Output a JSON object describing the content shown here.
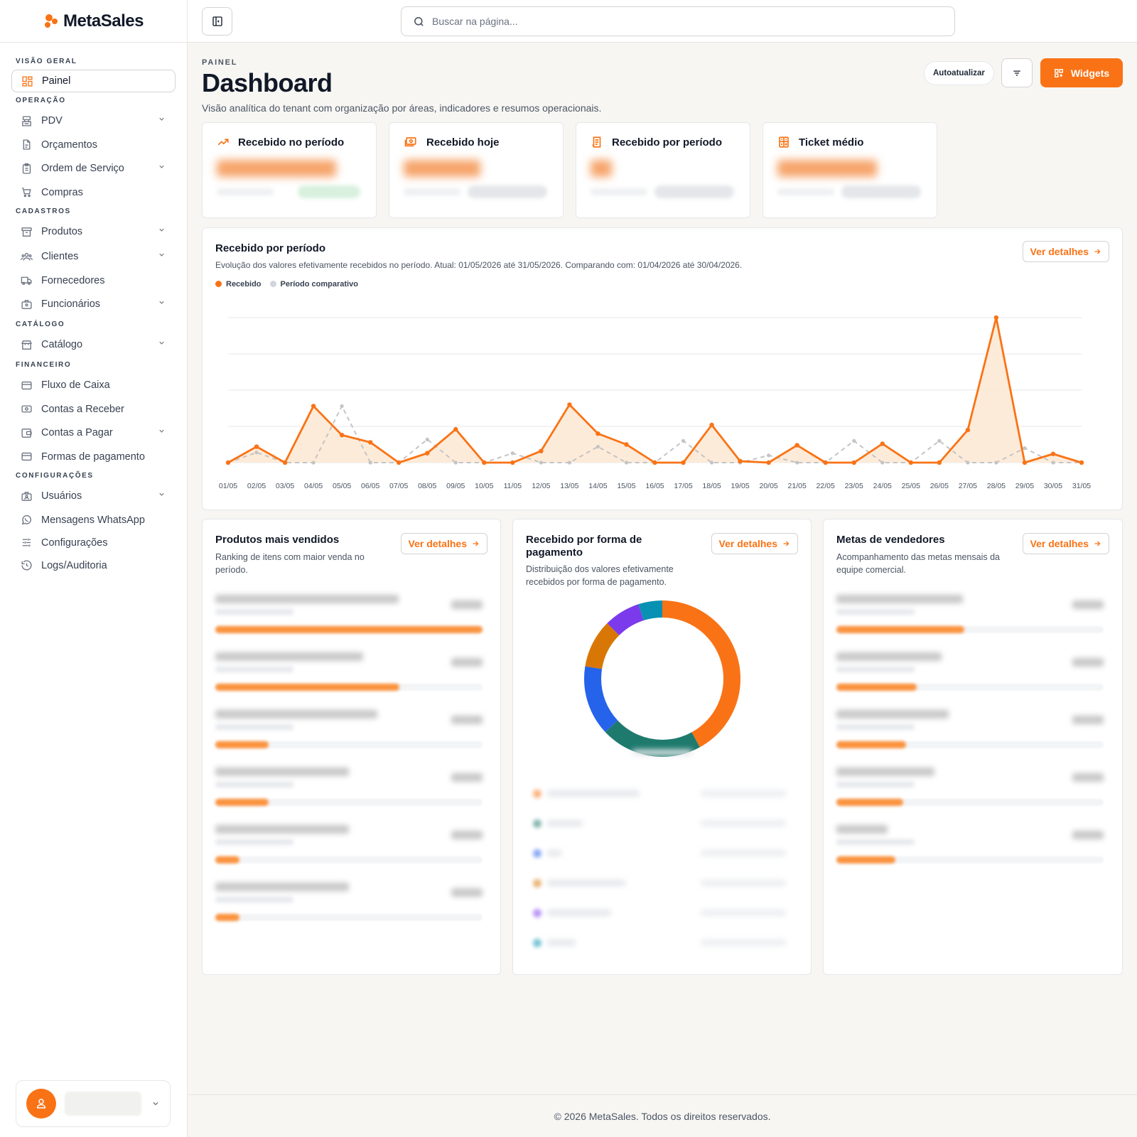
{
  "brand": {
    "name": "MetaSales"
  },
  "search": {
    "placeholder": "Buscar na página..."
  },
  "sidebar": {
    "sections": [
      {
        "title": "VISÃO GERAL",
        "items": [
          {
            "label": "Painel",
            "icon": "dashboard-icon",
            "active": true
          }
        ]
      },
      {
        "title": "OPERAÇÃO",
        "items": [
          {
            "label": "PDV",
            "icon": "register-icon",
            "expand": true
          },
          {
            "label": "Orçamentos",
            "icon": "document-icon"
          },
          {
            "label": "Ordem de Serviço",
            "icon": "clipboard-icon",
            "expand": true
          },
          {
            "label": "Compras",
            "icon": "cart-icon"
          }
        ]
      },
      {
        "title": "CADASTROS",
        "items": [
          {
            "label": "Produtos",
            "icon": "box-icon",
            "expand": true
          },
          {
            "label": "Clientes",
            "icon": "users-icon",
            "expand": true
          },
          {
            "label": "Fornecedores",
            "icon": "truck-icon"
          },
          {
            "label": "Funcionários",
            "icon": "briefcase-icon",
            "expand": true
          }
        ]
      },
      {
        "title": "CATÁLOGO",
        "items": [
          {
            "label": "Catálogo",
            "icon": "store-icon",
            "expand": true
          }
        ]
      },
      {
        "title": "FINANCEIRO",
        "items": [
          {
            "label": "Fluxo de Caixa",
            "icon": "credit-card-icon"
          },
          {
            "label": "Contas a Receber",
            "icon": "banknote-icon"
          },
          {
            "label": "Contas a Pagar",
            "icon": "wallet-icon",
            "expand": true
          },
          {
            "label": "Formas de pagamento",
            "icon": "credit-card-icon"
          }
        ]
      },
      {
        "title": "CONFIGURAÇÕES",
        "items": [
          {
            "label": "Usuários",
            "icon": "user-briefcase-icon",
            "expand": true
          },
          {
            "label": "Mensagens WhatsApp",
            "icon": "whatsapp-icon"
          },
          {
            "label": "Configurações",
            "icon": "sliders-icon"
          },
          {
            "label": "Logs/Auditoria",
            "icon": "history-icon"
          }
        ]
      }
    ]
  },
  "header": {
    "eyebrow": "PAINEL",
    "title": "Dashboard",
    "subtitle": "Visão analítica do tenant com organização por áreas, indicadores e resumos operacionais.",
    "auto_label": "Autoatualizar",
    "widgets_label": "Widgets"
  },
  "kpis": [
    {
      "label": "Recebido no período",
      "icon": "trending-up-icon"
    },
    {
      "label": "Recebido hoje",
      "icon": "cash-icon"
    },
    {
      "label": "Recebido por período",
      "icon": "receipt-icon"
    },
    {
      "label": "Ticket médio",
      "icon": "calculator-icon"
    }
  ],
  "chart_card": {
    "title": "Recebido por período",
    "subtitle": "Evolução dos valores efetivamente recebidos no período. Atual: 01/05/2026 até 31/05/2026. Comparando com: 01/04/2026 até 30/04/2026.",
    "details_label": "Ver detalhes"
  },
  "chart_data": {
    "type": "area",
    "categories": [
      "01/05",
      "02/05",
      "03/05",
      "04/05",
      "05/05",
      "06/05",
      "07/05",
      "08/05",
      "09/05",
      "10/05",
      "11/05",
      "12/05",
      "13/05",
      "14/05",
      "15/05",
      "16/05",
      "17/05",
      "18/05",
      "19/05",
      "20/05",
      "21/05",
      "22/05",
      "23/05",
      "24/05",
      "25/05",
      "26/05",
      "27/05",
      "28/05",
      "29/05",
      "30/05",
      "31/05"
    ],
    "series": [
      {
        "name": "Recebido",
        "color": "#f97316",
        "values": [
          0,
          22,
          0,
          78,
          38,
          28,
          0,
          13,
          46,
          0,
          0,
          16,
          80,
          40,
          25,
          0,
          0,
          52,
          2,
          0,
          24,
          0,
          0,
          26,
          0,
          0,
          45,
          200,
          0,
          12,
          0
        ]
      },
      {
        "name": "Período comparativo",
        "color": "#c4c4c4",
        "values": [
          0,
          14,
          0,
          0,
          78,
          0,
          0,
          32,
          0,
          0,
          13,
          0,
          0,
          22,
          0,
          0,
          30,
          0,
          0,
          10,
          0,
          0,
          30,
          0,
          0,
          30,
          0,
          0,
          20,
          0,
          0
        ]
      }
    ],
    "ylim": [
      0,
      200
    ],
    "grid": true,
    "legend": "top-left"
  },
  "products_card": {
    "title": "Produtos mais vendidos",
    "subtitle": "Ranking de itens com maior venda no período.",
    "details_label": "Ver detalhes",
    "fills": [
      1.0,
      0.69,
      0.2,
      0.2,
      0.09,
      0.09
    ]
  },
  "payment_card": {
    "title": "Recebido por forma de pagamento",
    "subtitle": "Distribuição dos valores efetivamente recebidos por forma de pagamento.",
    "details_label": "Ver detalhes",
    "slices": [
      {
        "value": 0.42,
        "color": "#f97316"
      },
      {
        "value": 0.21,
        "color": "#1f7a6e"
      },
      {
        "value": 0.145,
        "color": "#2563eb"
      },
      {
        "value": 0.1,
        "color": "#d97706"
      },
      {
        "value": 0.075,
        "color": "#7c3aed"
      },
      {
        "value": 0.05,
        "color": "#0891b2"
      }
    ]
  },
  "sellers_card": {
    "title": "Metas de vendedores",
    "subtitle": "Acompanhamento das metas mensais da equipe comercial.",
    "details_label": "Ver detalhes",
    "fills": [
      0.48,
      0.3,
      0.26,
      0.25,
      0.22
    ]
  },
  "footer": {
    "text": "© 2026 MetaSales. Todos os direitos reservados."
  }
}
